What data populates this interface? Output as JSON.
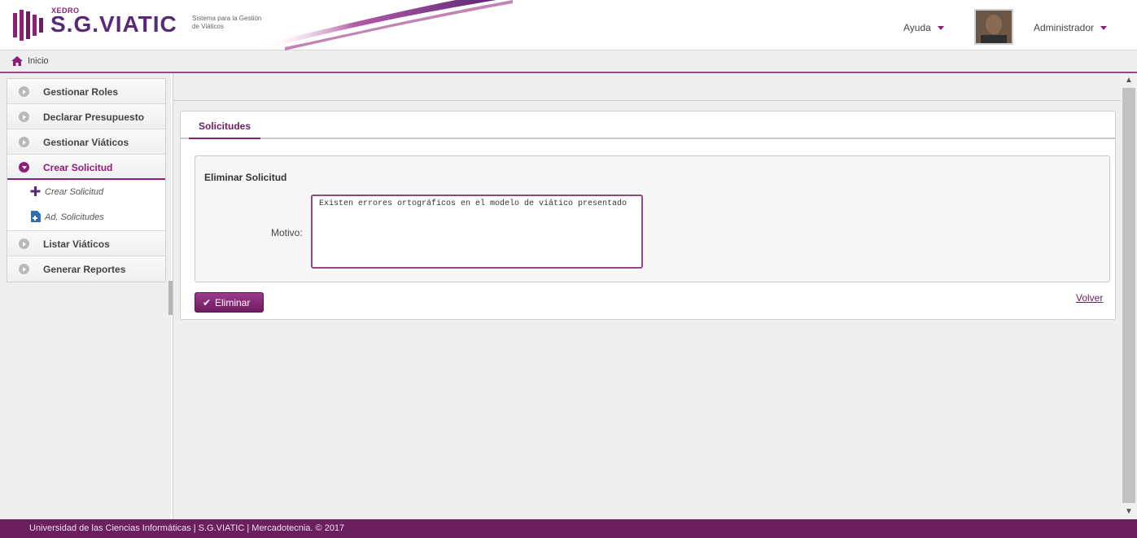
{
  "header": {
    "brand_small": "XEDRO",
    "brand_main": "S.G.VIATIC",
    "brand_sub": "Sistema para la Gestión de Viáticos",
    "help_label": "Ayuda",
    "user_label": "Administrador"
  },
  "breadcrumb": {
    "home_label": "Inicio"
  },
  "sidebar": {
    "items": [
      {
        "label": "Gestionar Roles"
      },
      {
        "label": "Declarar Presupuesto"
      },
      {
        "label": "Gestionar Viáticos"
      },
      {
        "label": "Crear Solicitud"
      },
      {
        "label": "Listar Viáticos"
      },
      {
        "label": "Generar Reportes"
      }
    ],
    "subitems": [
      {
        "label": "Crear Solicitud",
        "icon": "plus-icon"
      },
      {
        "label": "Ad. Solicitudes",
        "icon": "document-add-icon"
      }
    ]
  },
  "main": {
    "tab_label": "Solicitudes",
    "form_title": "Eliminar Solicitud",
    "motivo_label": "Motivo:",
    "motivo_value": "Existen errores ortográficos en el modelo de viático presentado",
    "delete_button": "Eliminar",
    "back_link": "Volver"
  },
  "footer": {
    "text": "Universidad de las Ciencias Informáticas | S.G.VIATIC | Mercadotecnia. © 2017"
  },
  "colors": {
    "accent": "#8c1f7a",
    "footer_bg": "#6b1f5e"
  }
}
